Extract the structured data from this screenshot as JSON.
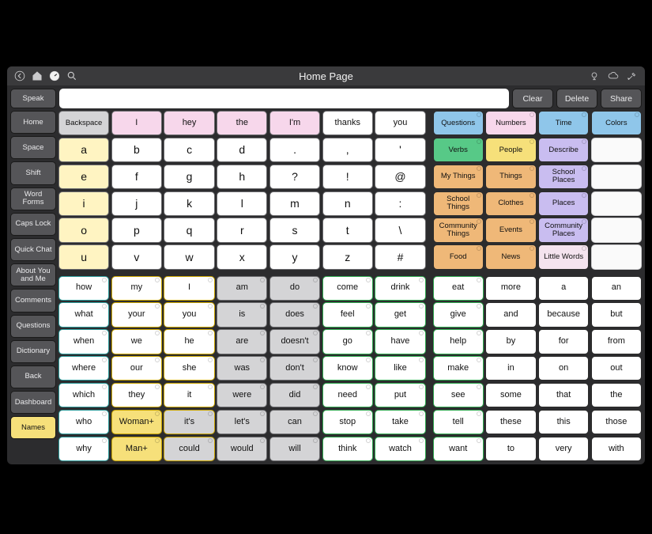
{
  "header": {
    "title": "Home Page"
  },
  "actions": {
    "speak": "Speak",
    "clear": "Clear",
    "delete": "Delete",
    "share": "Share"
  },
  "sidebar": [
    "Home",
    "Space",
    "Shift",
    "Word Forms",
    "Caps Lock",
    "Quick Chat",
    "About You and Me",
    "Comments",
    "Questions",
    "Dictionary",
    "Back",
    "Dashboard",
    "Names"
  ],
  "keyboard": {
    "top_row1": [
      "Backspace",
      "I",
      "hey",
      "the",
      "I'm",
      "thanks",
      "you"
    ],
    "rows": [
      [
        "a",
        "b",
        "c",
        "d",
        ".",
        ",",
        "'"
      ],
      [
        "e",
        "f",
        "g",
        "h",
        "?",
        "!",
        "@"
      ],
      [
        "i",
        "j",
        "k",
        "l",
        "m",
        "n",
        ":"
      ],
      [
        "o",
        "p",
        "q",
        "r",
        "s",
        "t",
        "\\"
      ],
      [
        "u",
        "v",
        "w",
        "x",
        "y",
        "z",
        "#"
      ]
    ]
  },
  "categories": [
    [
      "Questions",
      "Numbers",
      "Time",
      "Colors"
    ],
    [
      "Verbs",
      "People",
      "Describe",
      ""
    ],
    [
      "My Things",
      "Things",
      "School Places",
      ""
    ],
    [
      "School Things",
      "Clothes",
      "Places",
      ""
    ],
    [
      "Community Things",
      "Events",
      "Community Places",
      ""
    ],
    [
      "Food",
      "News",
      "Little Words",
      ""
    ]
  ],
  "words": {
    "rows": [
      [
        "how",
        "my",
        "I",
        "am",
        "do",
        "come",
        "drink",
        "eat",
        "more",
        "a",
        "an"
      ],
      [
        "what",
        "your",
        "you",
        "is",
        "does",
        "feel",
        "get",
        "give",
        "and",
        "because",
        "but"
      ],
      [
        "when",
        "we",
        "he",
        "are",
        "doesn't",
        "go",
        "have",
        "help",
        "by",
        "for",
        "from"
      ],
      [
        "where",
        "our",
        "she",
        "was",
        "don't",
        "know",
        "like",
        "make",
        "in",
        "on",
        "out"
      ],
      [
        "which",
        "they",
        "it",
        "were",
        "did",
        "need",
        "put",
        "see",
        "some",
        "that",
        "the"
      ],
      [
        "who",
        "Woman+",
        "it's",
        "let's",
        "can",
        "stop",
        "take",
        "tell",
        "these",
        "this",
        "those"
      ],
      [
        "why",
        "Man+",
        "could",
        "would",
        "will",
        "think",
        "watch",
        "want",
        "to",
        "very",
        "with"
      ]
    ]
  },
  "styles": {
    "cat_fill": [
      [
        "f-blue",
        "f-pink",
        "f-blue",
        "f-blue"
      ],
      [
        "f-green",
        "f-yellow",
        "f-purple",
        "empty"
      ],
      [
        "f-ltorange",
        "f-ltorange",
        "f-purple",
        "empty"
      ],
      [
        "f-ltorange",
        "f-ltorange",
        "f-purple",
        "empty"
      ],
      [
        "f-ltorange",
        "f-ltorange",
        "f-purple",
        "empty"
      ],
      [
        "f-ltorange",
        "f-ltorange",
        "f-lpink",
        "empty"
      ]
    ],
    "word_col_border": [
      "b-teal",
      "b-yellow",
      "b-yellow",
      "b-gray",
      "b-gray",
      "b-green",
      "b-green",
      "b-green",
      "b-dark",
      "b-dark",
      "b-dark"
    ],
    "word_col_fill_default": "f-white",
    "word_gray_cols": [
      3,
      4
    ],
    "word_yellow_cells": [
      [
        0,
        1
      ],
      [
        1,
        1
      ],
      [
        2,
        1
      ],
      [
        3,
        1
      ],
      [
        4,
        1
      ],
      [
        5,
        1
      ],
      [
        6,
        1
      ],
      [
        0,
        2
      ],
      [
        1,
        2
      ],
      [
        2,
        2
      ],
      [
        3,
        2
      ],
      [
        4,
        2
      ]
    ],
    "word_gray_override": [
      [
        5,
        2
      ],
      [
        5,
        3
      ],
      [
        6,
        2
      ],
      [
        6,
        3
      ]
    ],
    "word_bright_yellow": [
      [
        5,
        1
      ],
      [
        6,
        1
      ]
    ]
  }
}
